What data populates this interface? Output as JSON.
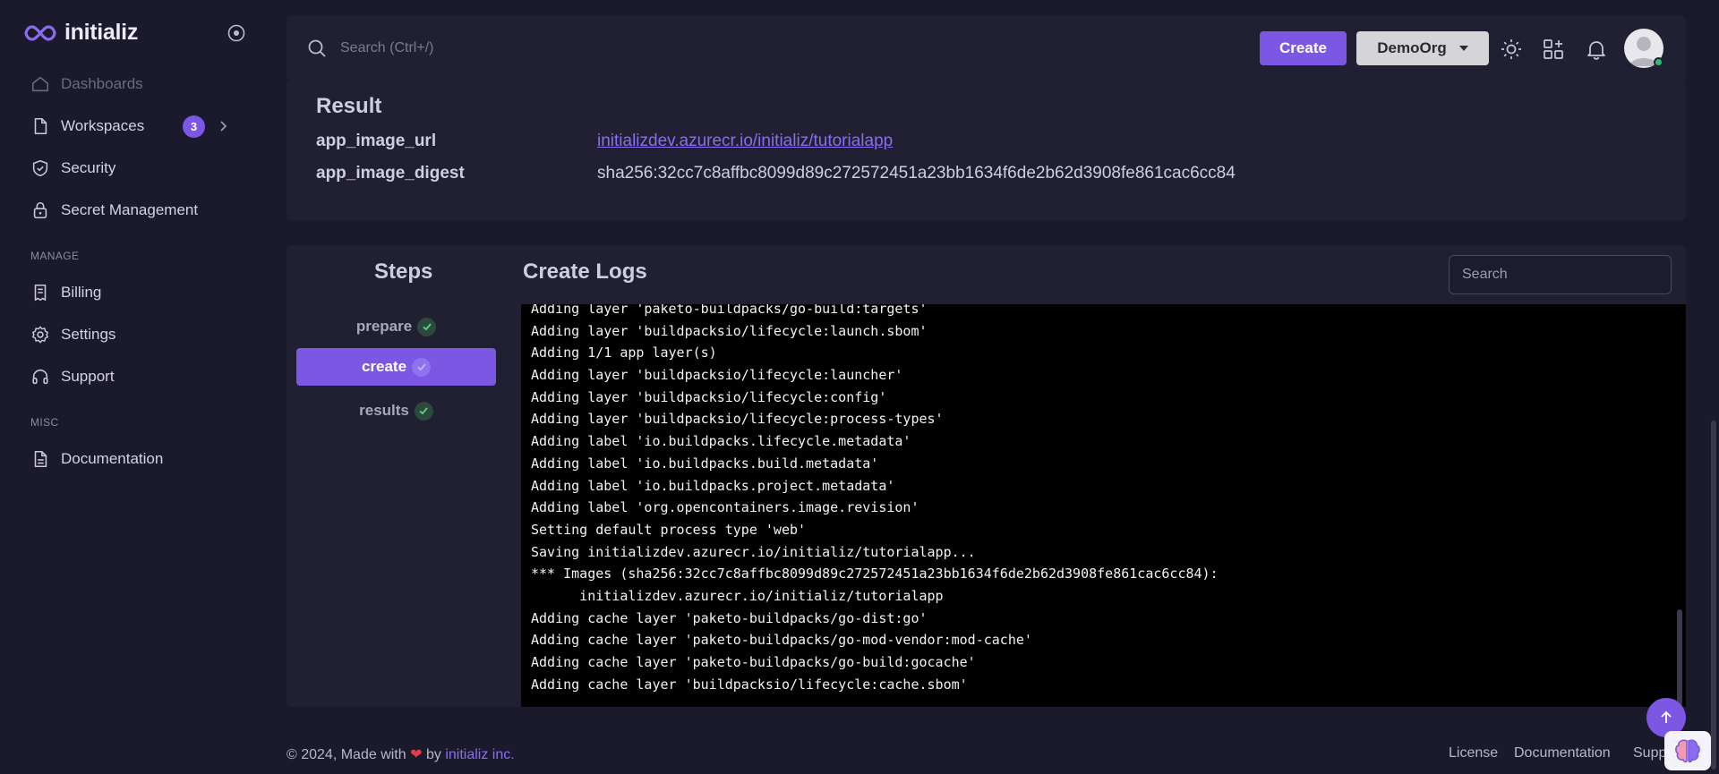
{
  "brand": {
    "name": "initializ"
  },
  "sidebar": {
    "items": [
      {
        "label": "Dashboards"
      },
      {
        "label": "Workspaces",
        "badge": "3"
      },
      {
        "label": "Security"
      },
      {
        "label": "Secret Management"
      }
    ],
    "sections": [
      {
        "title": "MANAGE",
        "items": [
          {
            "label": "Billing"
          },
          {
            "label": "Settings"
          },
          {
            "label": "Support"
          }
        ]
      },
      {
        "title": "MISC",
        "items": [
          {
            "label": "Documentation"
          }
        ]
      }
    ]
  },
  "topbar": {
    "search_placeholder": "Search (Ctrl+/)",
    "create_label": "Create",
    "org_label": "DemoOrg"
  },
  "result": {
    "title": "Result",
    "rows": [
      {
        "key": "app_image_url",
        "value": "initializdev.azurecr.io/initializ/tutorialapp",
        "is_link": true
      },
      {
        "key": "app_image_digest",
        "value": "sha256:32cc7c8affbc8099d89c272572451a23bb1634f6de2b62d3908fe861cac6cc84",
        "is_link": false
      }
    ]
  },
  "steps": {
    "title": "Steps",
    "items": [
      {
        "label": "prepare",
        "status": "done"
      },
      {
        "label": "create",
        "status": "done",
        "active": true
      },
      {
        "label": "results",
        "status": "done"
      }
    ]
  },
  "logs": {
    "title": "Create Logs",
    "search_placeholder": "Search",
    "lines": [
      "Adding layer 'paketo-buildpacks/go-build:targets'",
      "Adding layer 'buildpacksio/lifecycle:launch.sbom'",
      "Adding 1/1 app layer(s)",
      "Adding layer 'buildpacksio/lifecycle:launcher'",
      "Adding layer 'buildpacksio/lifecycle:config'",
      "Adding layer 'buildpacksio/lifecycle:process-types'",
      "Adding label 'io.buildpacks.lifecycle.metadata'",
      "Adding label 'io.buildpacks.build.metadata'",
      "Adding label 'io.buildpacks.project.metadata'",
      "Adding label 'org.opencontainers.image.revision'",
      "Setting default process type 'web'",
      "Saving initializdev.azurecr.io/initializ/tutorialapp...",
      "*** Images (sha256:32cc7c8affbc8099d89c272572451a23bb1634f6de2b62d3908fe861cac6cc84):",
      "      initializdev.azurecr.io/initializ/tutorialapp",
      "Adding cache layer 'paketo-buildpacks/go-dist:go'",
      "Adding cache layer 'paketo-buildpacks/go-mod-vendor:mod-cache'",
      "Adding cache layer 'paketo-buildpacks/go-build:gocache'",
      "Adding cache layer 'buildpacksio/lifecycle:cache.sbom'"
    ]
  },
  "footer": {
    "copyright_prefix": "© 2024, Made with",
    "heart": "❤",
    "by": "by",
    "company": "initializ inc.",
    "links": [
      "License",
      "Documentation",
      "Supp"
    ]
  },
  "colors": {
    "accent": "#7b57e4",
    "link": "#8a6cf0",
    "success": "#29c16b"
  }
}
